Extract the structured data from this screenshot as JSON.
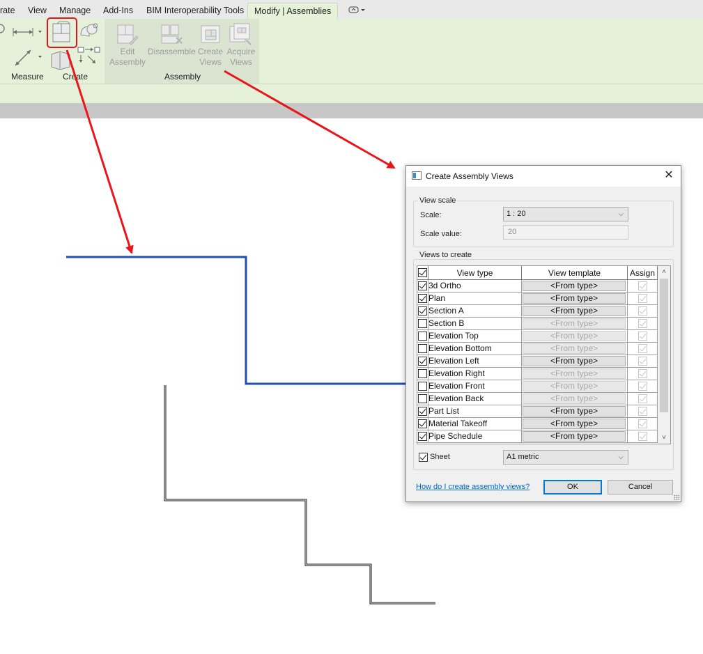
{
  "ribbon": {
    "tabs": [
      {
        "label": "rate"
      },
      {
        "label": "View"
      },
      {
        "label": "Manage"
      },
      {
        "label": "Add-Ins"
      },
      {
        "label": "BIM Interoperability Tools"
      },
      {
        "label": "Modify | Assemblies"
      }
    ],
    "active_tab": "Modify | Assemblies",
    "panels": {
      "measure_label": "Measure",
      "create_label": "Create",
      "assembly_label": "Assembly"
    },
    "assembly_buttons": [
      {
        "label": "Edit\nAssembly",
        "line1": "Edit",
        "line2": "Assembly"
      },
      {
        "label": "Disassemble",
        "line1": "Disassemble",
        "line2": ""
      },
      {
        "label": "Create\nViews",
        "line1": "Create",
        "line2": "Views"
      },
      {
        "label": "Acquire\nViews",
        "line1": "Acquire",
        "line2": "Views"
      }
    ],
    "annotation_color": "#e0161b"
  },
  "dialog": {
    "title": "Create Assembly Views",
    "view_scale_group": "View scale",
    "scale_label": "Scale:",
    "scale_value_selected": "1 : 20",
    "scale_value_label": "Scale value:",
    "scale_value": "20",
    "views_group": "Views to create",
    "columns": {
      "view_type": "View type",
      "view_template": "View template",
      "assign": "Assign"
    },
    "header_checked": true,
    "rows": [
      {
        "name": "3d Ortho",
        "checked": true,
        "template": "<From type>"
      },
      {
        "name": "Plan",
        "checked": true,
        "template": "<From type>"
      },
      {
        "name": "Section A",
        "checked": true,
        "template": "<From type>"
      },
      {
        "name": "Section B",
        "checked": false,
        "template": "<From type>"
      },
      {
        "name": "Elevation Top",
        "checked": false,
        "template": "<From type>"
      },
      {
        "name": "Elevation Bottom",
        "checked": false,
        "template": "<From type>"
      },
      {
        "name": "Elevation Left",
        "checked": true,
        "template": "<From type>"
      },
      {
        "name": "Elevation Right",
        "checked": false,
        "template": "<From type>"
      },
      {
        "name": "Elevation Front",
        "checked": false,
        "template": "<From type>"
      },
      {
        "name": "Elevation Back",
        "checked": false,
        "template": "<From type>"
      },
      {
        "name": "Part List",
        "checked": true,
        "template": "<From type>"
      },
      {
        "name": "Material Takeoff",
        "checked": true,
        "template": "<From type>"
      },
      {
        "name": "Pipe Schedule",
        "checked": true,
        "template": "<From type>"
      }
    ],
    "sheet_label": "Sheet",
    "sheet_checked": true,
    "sheet_value": "A1 metric",
    "help_link": "How do I create assembly views?",
    "ok_label": "OK",
    "cancel_label": "Cancel"
  },
  "colors": {
    "selected_line": "#1e4fb5",
    "annotation_arrow": "#e8161b",
    "ribbon_bg": "#e6f1d9"
  }
}
